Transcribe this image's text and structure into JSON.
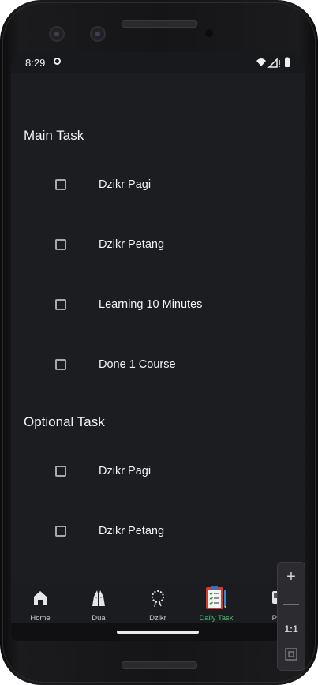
{
  "status": {
    "time": "8:29"
  },
  "sections": {
    "main": {
      "title": "Main Task",
      "tasks": [
        {
          "label": "Dzikr Pagi",
          "checked": false
        },
        {
          "label": "Dzikr Petang",
          "checked": false
        },
        {
          "label": "Learning 10 Minutes",
          "checked": false
        },
        {
          "label": "Done 1 Course",
          "checked": false
        }
      ]
    },
    "optional": {
      "title": "Optional Task",
      "tasks": [
        {
          "label": "Dzikr Pagi",
          "checked": false
        },
        {
          "label": "Dzikr Petang",
          "checked": false
        }
      ]
    }
  },
  "bottom_nav": {
    "items": [
      {
        "label": "Home",
        "icon": "home-icon"
      },
      {
        "label": "Dua",
        "icon": "praying-hands-icon"
      },
      {
        "label": "Dzikr",
        "icon": "prayer-beads-icon"
      },
      {
        "label": "Daily Task",
        "icon": "clipboard-checklist-icon",
        "active": true
      },
      {
        "label": "Pro",
        "icon": "profile-icon"
      }
    ],
    "active_color": "#44c06c"
  },
  "emulator_controls": {
    "zoom_in": "+",
    "zoom_out": "—",
    "reset": "1:1"
  }
}
